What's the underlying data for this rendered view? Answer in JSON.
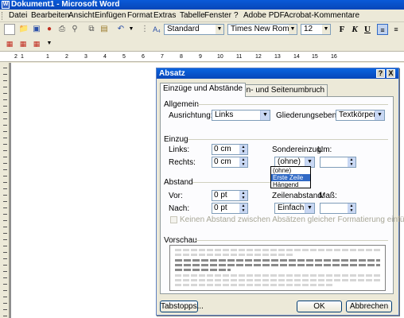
{
  "window": {
    "title": "Dokument1 - Microsoft Word"
  },
  "menu": [
    "Datei",
    "Bearbeiten",
    "Ansicht",
    "Einfügen",
    "Format",
    "Extras",
    "Tabelle",
    "Fenster",
    "?",
    "Adobe PDF",
    "Acrobat-Kommentare"
  ],
  "toolbar": {
    "style_value": "Standard",
    "font_value": "Times New Roman",
    "size_value": "12",
    "bold_label": "F",
    "italic_label": "K",
    "underline_label": "U",
    "style_glyph": "A₄"
  },
  "ruler": {
    "labels": [
      "1",
      "2",
      "1",
      "2",
      "3",
      "4",
      "5",
      "6",
      "7",
      "8",
      "9",
      "10",
      "11",
      "12",
      "13",
      "14",
      "15",
      "16"
    ]
  },
  "dialog": {
    "title": "Absatz",
    "help_btn": "?",
    "close_btn": "X",
    "tabs": [
      "Einzüge und Abstände",
      "Zeilen- und Seitenumbruch"
    ],
    "sections": {
      "allgemein": "Allgemein",
      "einzug": "Einzug",
      "abstand": "Abstand",
      "vorschau": "Vorschau"
    },
    "labels": {
      "ausrichtung": "Ausrichtung:",
      "gliederungsebene": "Gliederungsebene:",
      "links": "Links:",
      "rechts": "Rechts:",
      "sondereinzug": "Sondereinzug:",
      "um": "Um:",
      "vor": "Vor:",
      "nach": "Nach:",
      "zeilenabstand": "Zeilenabstand:",
      "mass": "Maß:"
    },
    "values": {
      "ausrichtung": "Links",
      "gliederungsebene": "Textkörper",
      "links": "0 cm",
      "rechts": "0 cm",
      "sondereinzug": "(ohne)",
      "um": "",
      "vor": "0 pt",
      "nach": "0 pt",
      "zeilenabstand": "Einfach",
      "mass": ""
    },
    "sondereinzug_options": [
      {
        "label": "(ohne)",
        "selected": false
      },
      {
        "label": "Erste Zeile",
        "selected": true
      },
      {
        "label": "Hängend",
        "selected": false
      }
    ],
    "checkbox_label": "Keinen Abstand zwischen Absätzen gleicher Formatierung einfügen",
    "checkbox_checked": false,
    "buttons": {
      "tabstopps": "Tabstopps...",
      "ok": "OK",
      "abbrechen": "Abbrechen"
    }
  },
  "colors": {
    "titlebar": "#0a5ad8",
    "dialog_bg": "#ece9d8",
    "selection": "#316ac5"
  }
}
